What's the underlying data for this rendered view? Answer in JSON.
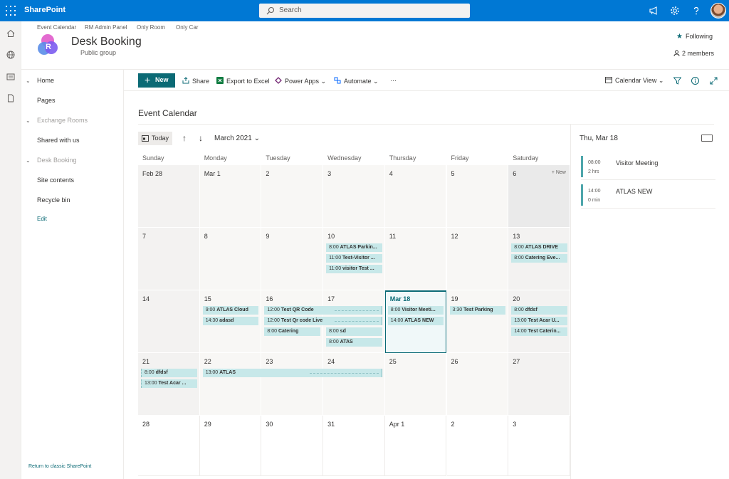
{
  "suite": {
    "brand": "SharePoint",
    "search_placeholder": "Search"
  },
  "hub": {
    "links": [
      "Event Calendar",
      "RM Admin Panel",
      "Only Room",
      "Only Car"
    ]
  },
  "site": {
    "logo_letter": "R",
    "title": "Desk Booking",
    "subtitle": "Public group",
    "following": "Following",
    "members": "2 members"
  },
  "nav": {
    "items": [
      {
        "label": "Home",
        "muted": false,
        "chevron": true
      },
      {
        "label": "Pages",
        "muted": false,
        "chevron": false
      },
      {
        "label": "Exchange Rooms",
        "muted": true,
        "chevron": true
      },
      {
        "label": "Shared with us",
        "muted": false,
        "chevron": false
      },
      {
        "label": "Desk Booking",
        "muted": true,
        "chevron": true
      },
      {
        "label": "Site contents",
        "muted": false,
        "chevron": false
      },
      {
        "label": "Recycle bin",
        "muted": false,
        "chevron": false
      }
    ],
    "edit": "Edit",
    "classic": "Return to classic SharePoint"
  },
  "commands": {
    "new": "New",
    "share": "Share",
    "export": "Export to Excel",
    "powerapps": "Power Apps",
    "automate": "Automate",
    "more": "···",
    "view": "Calendar View"
  },
  "calendar": {
    "title": "Event Calendar",
    "today_label": "Today",
    "month_label": "March 2021",
    "days_of_week": [
      "Sunday",
      "Monday",
      "Tuesday",
      "Wednesday",
      "Thursday",
      "Friday",
      "Saturday"
    ],
    "cell_new_label": "+ New",
    "weeks": [
      [
        "Feb 28",
        "Mar 1",
        "2",
        "3",
        "4",
        "5",
        "6"
      ],
      [
        "7",
        "8",
        "9",
        "10",
        "11",
        "12",
        "13"
      ],
      [
        "14",
        "15",
        "16",
        "17",
        "Mar 18",
        "19",
        "20"
      ],
      [
        "21",
        "22",
        "23",
        "24",
        "25",
        "26",
        "27"
      ],
      [
        "28",
        "29",
        "30",
        "31",
        "Apr 1",
        "2",
        "3"
      ]
    ],
    "events": [
      {
        "week": 1,
        "day": 3,
        "slot": 0,
        "span": 1,
        "time": "8:00",
        "title": "ATLAS Parkin..."
      },
      {
        "week": 1,
        "day": 3,
        "slot": 1,
        "span": 1,
        "time": "11:00",
        "title": "Test-Visitor ..."
      },
      {
        "week": 1,
        "day": 3,
        "slot": 2,
        "span": 1,
        "time": "11:00",
        "title": "visitor Test ..."
      },
      {
        "week": 1,
        "day": 6,
        "slot": 0,
        "span": 1,
        "time": "8:00",
        "title": "ATLAS DRIVE"
      },
      {
        "week": 1,
        "day": 6,
        "slot": 1,
        "span": 1,
        "time": "8:00",
        "title": "Catering Eve..."
      },
      {
        "week": 2,
        "day": 1,
        "slot": 0,
        "span": 1,
        "time": "9:00",
        "title": "ATLAS Cloud"
      },
      {
        "week": 2,
        "day": 1,
        "slot": 1,
        "span": 1,
        "time": "14:30",
        "title": "adasd"
      },
      {
        "week": 2,
        "day": 2,
        "slot": 0,
        "span": 2,
        "time": "12:00",
        "title": "Test QR Code"
      },
      {
        "week": 2,
        "day": 2,
        "slot": 1,
        "span": 2,
        "time": "12:00",
        "title": "Test Qr code Live"
      },
      {
        "week": 2,
        "day": 2,
        "slot": 2,
        "span": 1,
        "time": "8:00",
        "title": "Catering"
      },
      {
        "week": 2,
        "day": 3,
        "slot": 2,
        "span": 1,
        "time": "8:00",
        "title": "sd"
      },
      {
        "week": 2,
        "day": 3,
        "slot": 3,
        "span": 1,
        "time": "8:00",
        "title": "ATAS"
      },
      {
        "week": 2,
        "day": 4,
        "slot": 0,
        "span": 1,
        "time": "8:00",
        "title": "Visitor Meeti..."
      },
      {
        "week": 2,
        "day": 4,
        "slot": 1,
        "span": 1,
        "time": "14:00",
        "title": "ATLAS NEW"
      },
      {
        "week": 2,
        "day": 5,
        "slot": 0,
        "span": 1,
        "time": "3:30",
        "title": "Test Parking"
      },
      {
        "week": 2,
        "day": 6,
        "slot": 0,
        "span": 1,
        "time": "8:00",
        "title": "dfdsf"
      },
      {
        "week": 2,
        "day": 6,
        "slot": 1,
        "span": 1,
        "time": "13:00",
        "title": "Test Acar U..."
      },
      {
        "week": 2,
        "day": 6,
        "slot": 2,
        "span": 1,
        "time": "14:00",
        "title": "Test Caterin..."
      },
      {
        "week": 3,
        "day": 0,
        "slot": 0,
        "span": 1,
        "time": "8:00",
        "title": "dfdsf"
      },
      {
        "week": 3,
        "day": 0,
        "slot": 1,
        "span": 1,
        "time": "13:00",
        "title": "Test Acar ..."
      },
      {
        "week": 3,
        "day": 1,
        "slot": 0,
        "span": 3,
        "time": "13:00",
        "title": "ATLAS"
      }
    ]
  },
  "panel": {
    "date": "Thu, Mar 18",
    "events": [
      {
        "time": "08:00",
        "duration": "2 hrs",
        "title": "Visitor Meeting"
      },
      {
        "time": "14:00",
        "duration": "0 min",
        "title": "ATLAS NEW"
      }
    ]
  },
  "colors": {
    "suite": "#0078d4",
    "accent": "#0b6a75",
    "event": "#c7e8e9"
  }
}
